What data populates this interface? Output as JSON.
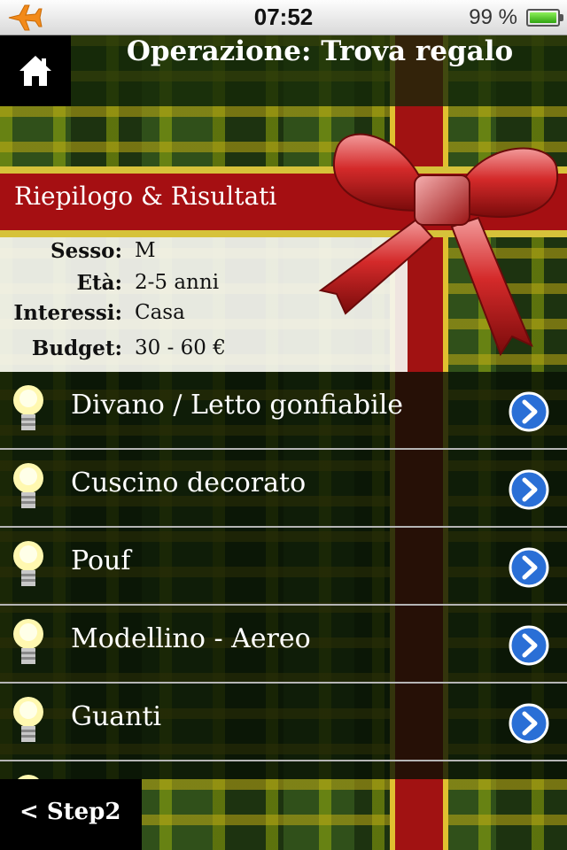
{
  "status": {
    "time": "07:52",
    "battery": "99 %",
    "battery_level": 0.99
  },
  "header": {
    "title": "Operazione: Trova regalo"
  },
  "section": {
    "label": "Riepilogo & Risultati"
  },
  "summary": [
    {
      "label": "Sesso:",
      "value": "M"
    },
    {
      "label": "Età:",
      "value": "2-5 anni"
    },
    {
      "label": "Interessi:",
      "value": "Casa"
    },
    {
      "label": "Budget:",
      "value": "30 - 60 €"
    }
  ],
  "results": [
    {
      "label": "Divano / Letto gonfiabile"
    },
    {
      "label": "Cuscino decorato"
    },
    {
      "label": "Pouf"
    },
    {
      "label": "Modellino - Aereo"
    },
    {
      "label": "Guanti"
    },
    {
      "label": ""
    }
  ],
  "footer": {
    "back_label": "< Step2"
  },
  "colors": {
    "accent_red": "#a50f12",
    "band_gold": "#d6c23a",
    "chevron_blue": "#2a6fd6"
  }
}
